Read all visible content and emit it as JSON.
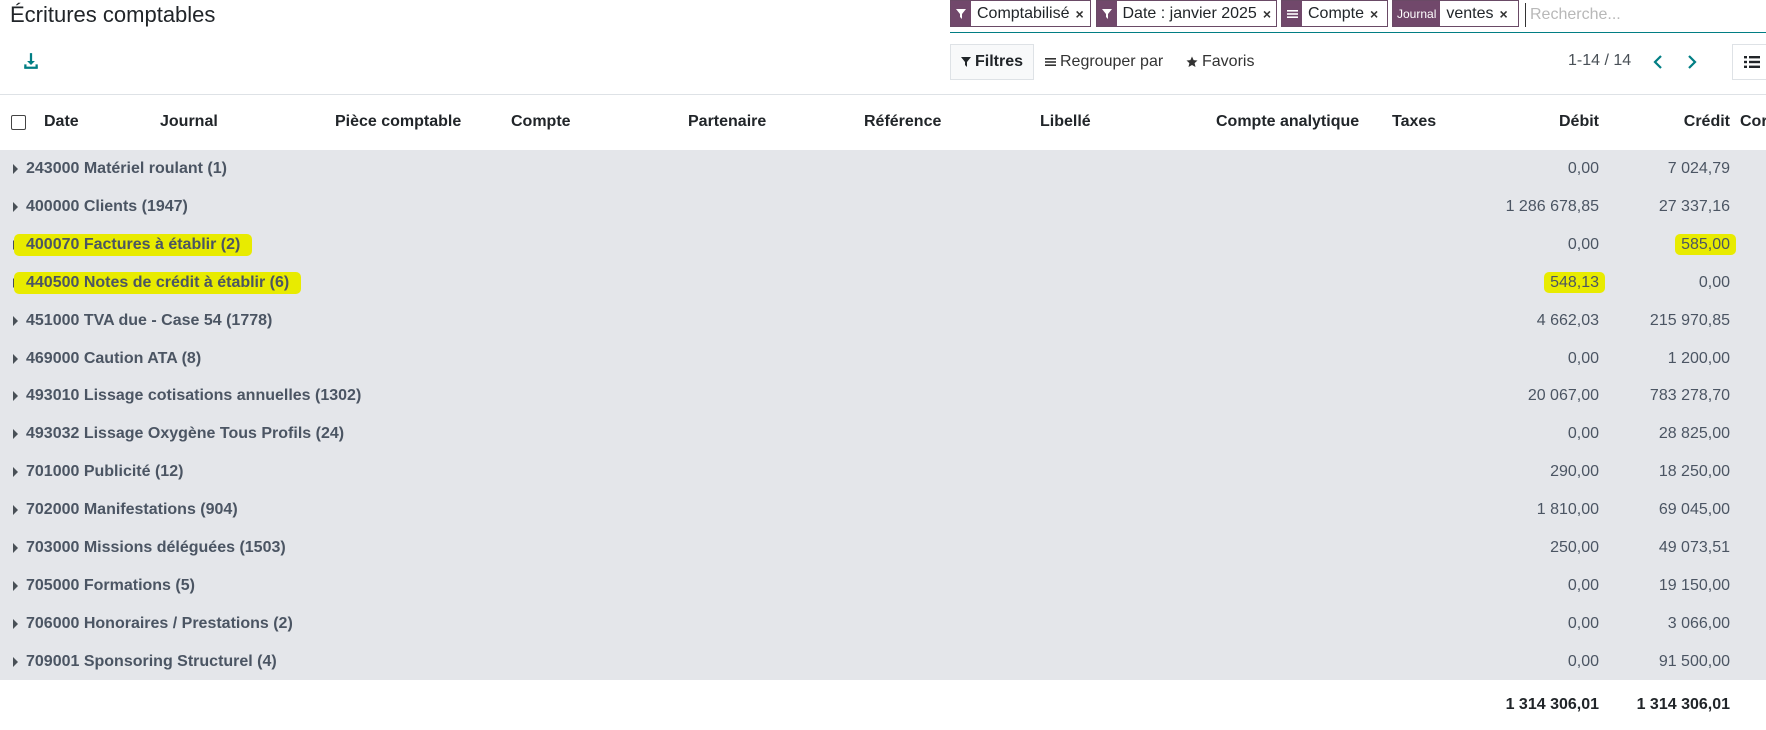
{
  "page": {
    "title": "Écritures comptables"
  },
  "search": {
    "facets": [
      {
        "icon": "filter-icon",
        "value": "Comptabilisé"
      },
      {
        "icon": "filter-icon",
        "value": "Date : janvier 2025"
      },
      {
        "icon": "group-icon",
        "value": "Compte"
      },
      {
        "icon": "Journal",
        "value": "ventes"
      }
    ],
    "placeholder": "Recherche..."
  },
  "toolbar": {
    "filters": "Filtres",
    "group_by": "Regrouper par",
    "favorites": "Favoris",
    "pager": "1-14 / 14"
  },
  "table": {
    "columns": [
      "Date",
      "Journal",
      "Pièce comptable",
      "Compte",
      "Partenaire",
      "Référence",
      "Libellé",
      "Compte analytique",
      "Taxes",
      "Débit",
      "Crédit",
      "Cor"
    ],
    "groups": [
      {
        "label": "243000 Matériel roulant (1)",
        "debit": "0,00",
        "credit": "7 024,79",
        "hl_label": false,
        "hl_debit": false,
        "hl_credit": false
      },
      {
        "label": "400000 Clients (1947)",
        "debit": "1 286 678,85",
        "credit": "27 337,16",
        "hl_label": false,
        "hl_debit": false,
        "hl_credit": false
      },
      {
        "label": "400070 Factures à établir (2)",
        "debit": "0,00",
        "credit": "585,00",
        "hl_label": true,
        "hl_debit": false,
        "hl_credit": true
      },
      {
        "label": "440500 Notes de crédit à établir (6)",
        "debit": "548,13",
        "credit": "0,00",
        "hl_label": true,
        "hl_debit": true,
        "hl_credit": false
      },
      {
        "label": "451000 TVA due - Case 54 (1778)",
        "debit": "4 662,03",
        "credit": "215 970,85",
        "hl_label": false,
        "hl_debit": false,
        "hl_credit": false
      },
      {
        "label": "469000 Caution ATA (8)",
        "debit": "0,00",
        "credit": "1 200,00",
        "hl_label": false,
        "hl_debit": false,
        "hl_credit": false
      },
      {
        "label": "493010 Lissage cotisations annuelles (1302)",
        "debit": "20 067,00",
        "credit": "783 278,70",
        "hl_label": false,
        "hl_debit": false,
        "hl_credit": false
      },
      {
        "label": "493032 Lissage Oxygène Tous Profils (24)",
        "debit": "0,00",
        "credit": "28 825,00",
        "hl_label": false,
        "hl_debit": false,
        "hl_credit": false
      },
      {
        "label": "701000 Publicité (12)",
        "debit": "290,00",
        "credit": "18 250,00",
        "hl_label": false,
        "hl_debit": false,
        "hl_credit": false
      },
      {
        "label": "702000 Manifestations (904)",
        "debit": "1 810,00",
        "credit": "69 045,00",
        "hl_label": false,
        "hl_debit": false,
        "hl_credit": false
      },
      {
        "label": "703000 Missions déléguées (1503)",
        "debit": "250,00",
        "credit": "49 073,51",
        "hl_label": false,
        "hl_debit": false,
        "hl_credit": false
      },
      {
        "label": "705000 Formations (5)",
        "debit": "0,00",
        "credit": "19 150,00",
        "hl_label": false,
        "hl_debit": false,
        "hl_credit": false
      },
      {
        "label": "706000 Honoraires / Prestations (2)",
        "debit": "0,00",
        "credit": "3 066,00",
        "hl_label": false,
        "hl_debit": false,
        "hl_credit": false
      },
      {
        "label": "709001 Sponsoring Structurel (4)",
        "debit": "0,00",
        "credit": "91 500,00",
        "hl_label": false,
        "hl_debit": false,
        "hl_credit": false
      }
    ],
    "totals": {
      "debit": "1 314 306,01",
      "credit": "1 314 306,01"
    }
  },
  "colors": {
    "accent": "#017e84",
    "facet": "#71486b",
    "highlight": "#e8eb00",
    "group_bg": "#e4e6ea"
  }
}
